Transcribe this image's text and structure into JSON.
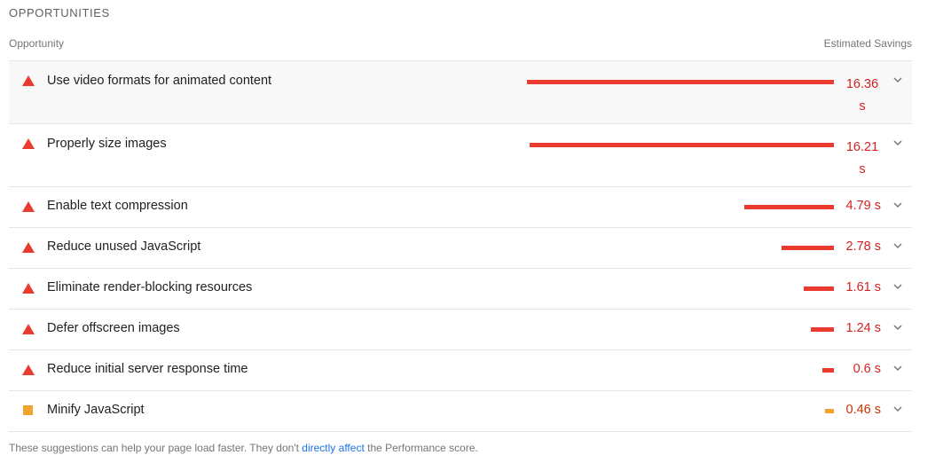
{
  "section": {
    "title": "OPPORTUNITIES"
  },
  "table": {
    "col_opportunity": "Opportunity",
    "col_savings": "Estimated Savings",
    "rows": [
      {
        "label": "Use video formats for animated content",
        "savings_value": "16.36",
        "savings_unit": "s",
        "severity": "fail",
        "bar_fraction": 1.0
      },
      {
        "label": "Properly size images",
        "savings_value": "16.21",
        "savings_unit": "s",
        "severity": "fail",
        "bar_fraction": 0.99
      },
      {
        "label": "Enable text compression",
        "savings": "4.79 s",
        "severity": "fail",
        "bar_fraction": 0.293
      },
      {
        "label": "Reduce unused JavaScript",
        "savings": "2.78 s",
        "severity": "fail",
        "bar_fraction": 0.17
      },
      {
        "label": "Eliminate render-blocking resources",
        "savings": "1.61 s",
        "severity": "fail",
        "bar_fraction": 0.098
      },
      {
        "label": "Defer offscreen images",
        "savings": "1.24 s",
        "severity": "fail",
        "bar_fraction": 0.076
      },
      {
        "label": "Reduce initial server response time",
        "savings": "0.6 s",
        "severity": "fail",
        "bar_fraction": 0.037
      },
      {
        "label": "Minify JavaScript",
        "savings": "0.46 s",
        "severity": "average",
        "bar_fraction": 0.028
      }
    ]
  },
  "footer": {
    "text_before": "These suggestions can help your page load faster. They don't ",
    "link_text": "directly affect",
    "text_after": " the Performance score."
  },
  "colors": {
    "fail": "#eb3b2e",
    "average": "#f0a32f",
    "link": "#1a73e8"
  }
}
